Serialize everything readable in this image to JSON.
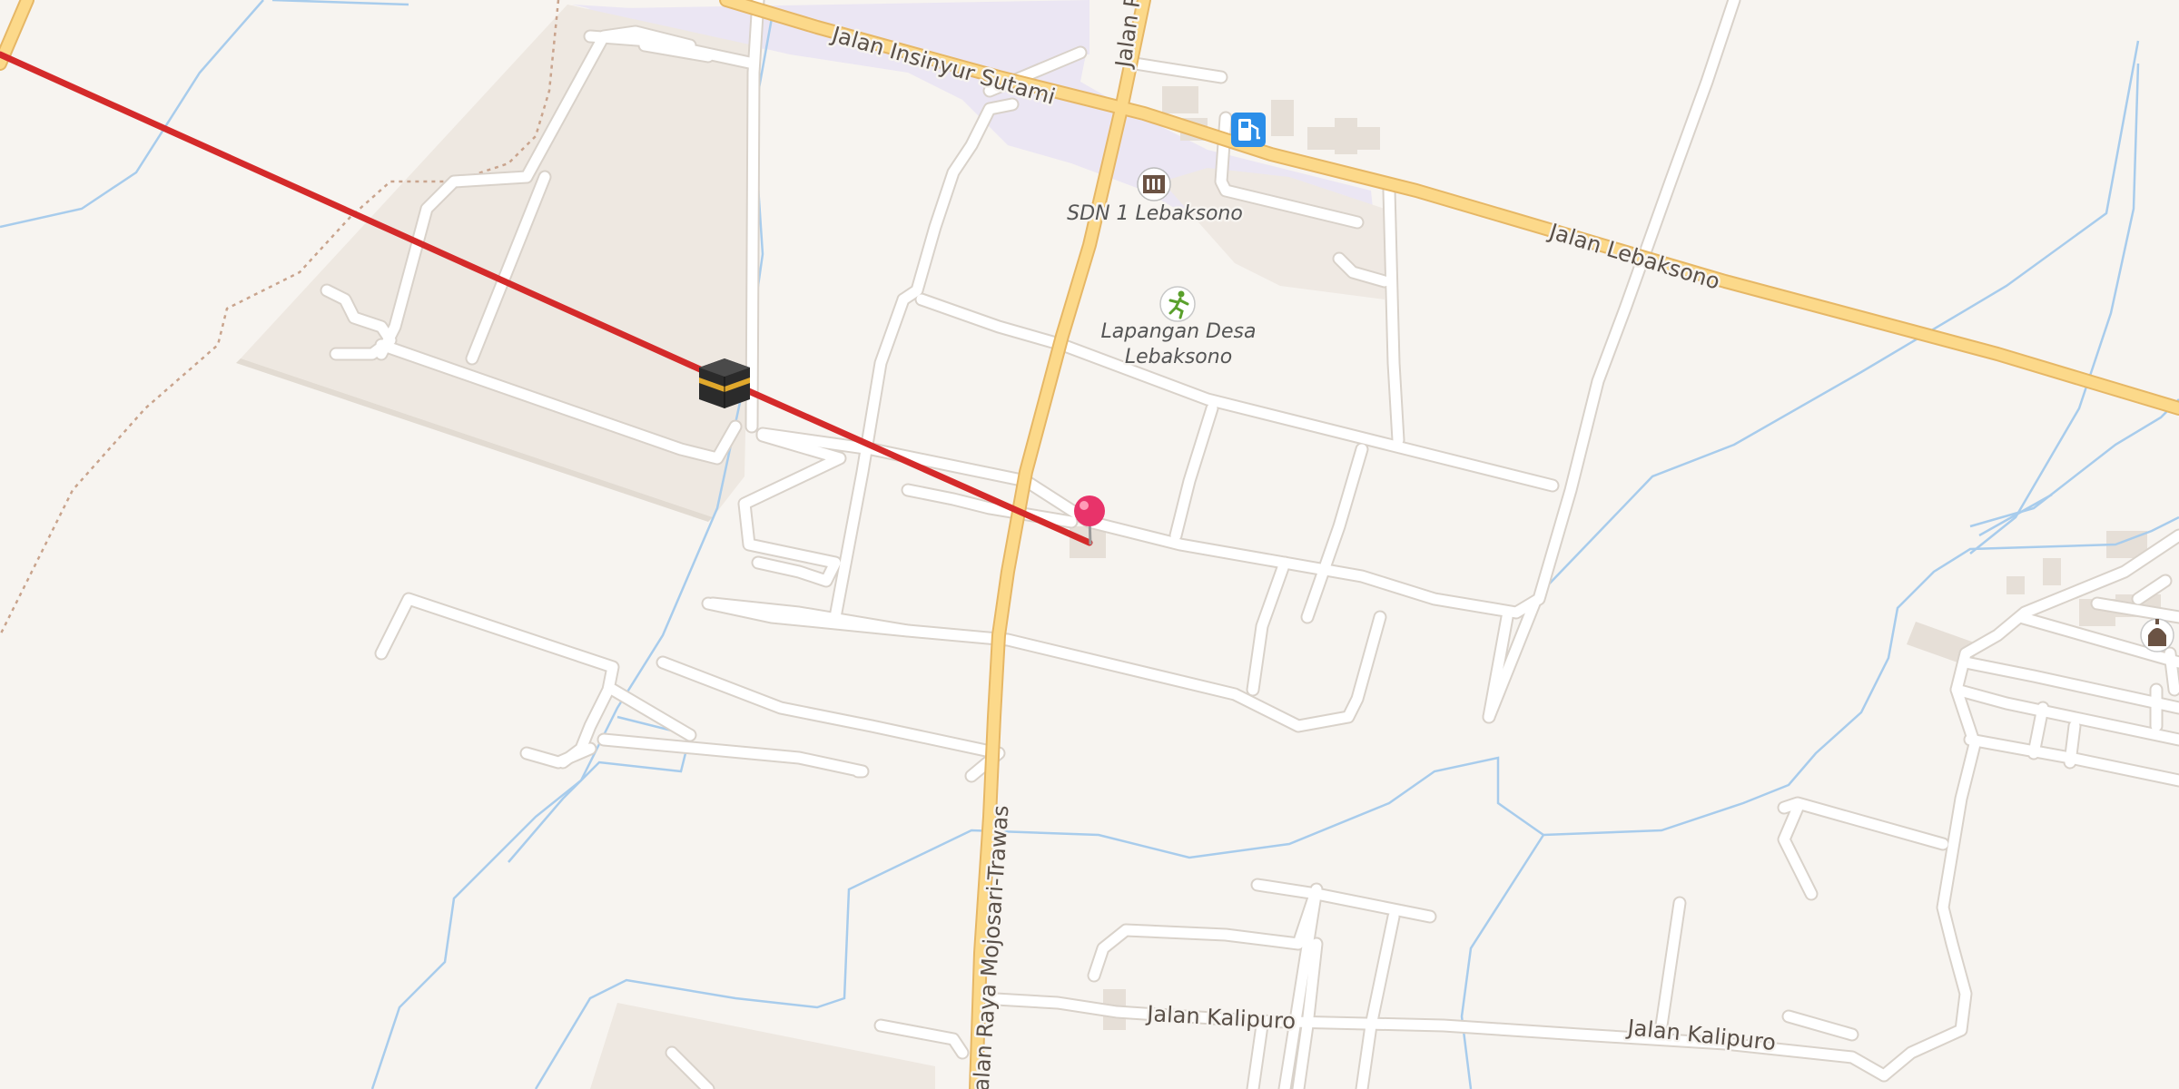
{
  "map": {
    "colors": {
      "background": "#f7f4f0",
      "water": "#a8ccec",
      "minor_road": "#ffffff",
      "major_road": "#fcd98a",
      "route_line": "#d42a2a",
      "pin": "#e8336a",
      "school_area": "#ece7f5",
      "building": "#e8e1d9"
    },
    "roads": {
      "insinyur_sutami": "Jalan Insinyur Sutami",
      "raya_top": "Jalan Raya",
      "lebaksono": "Jalan Lebaksono",
      "mojosari_trawas": "Jalan Raya Mojosari-Trawas",
      "kalipuro_1": "Jalan Kalipuro",
      "kalipuro_2": "Jalan Kalipuro"
    },
    "pois": {
      "school": {
        "label": "SDN 1 Lebaksono",
        "icon": "school-icon"
      },
      "field": {
        "label_line1": "Lapangan Desa",
        "label_line2": "Lebaksono",
        "icon": "sports-field-icon"
      },
      "fuel": {
        "icon": "fuel-station-icon"
      },
      "kaaba": {
        "icon": "kaaba-qibla-icon"
      },
      "mosque": {
        "icon": "mosque-icon"
      },
      "pin": {
        "icon": "location-pin-icon"
      }
    }
  }
}
